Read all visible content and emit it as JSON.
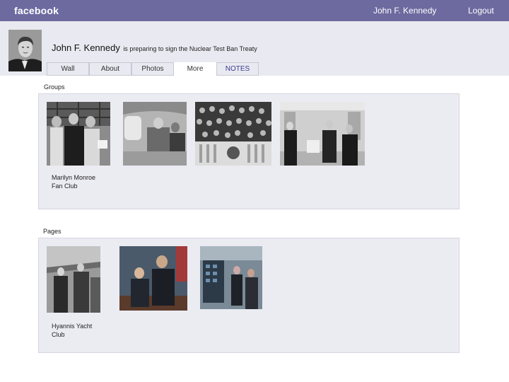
{
  "header": {
    "logo": "facebook",
    "user_name": "John F. Kennedy",
    "logout": "Logout"
  },
  "profile": {
    "name": "John F. Kennedy",
    "status": "is preparing to sign the Nuclear Test Ban Treaty"
  },
  "tabs": [
    {
      "label": "Wall"
    },
    {
      "label": "About"
    },
    {
      "label": "Photos"
    },
    {
      "label": "More",
      "active": true
    },
    {
      "label": "NOTES"
    }
  ],
  "groups": {
    "heading": "Groups",
    "items": [
      {
        "caption_line1": "Marilyn Monroe",
        "caption_line2": "Fan Club",
        "photo": "wedding-photo"
      },
      {
        "caption_line1": "",
        "caption_line2": "",
        "photo": "airplane-photo"
      },
      {
        "caption_line1": "",
        "caption_line2": "",
        "photo": "crowd-photo"
      },
      {
        "caption_line1": "",
        "caption_line2": "",
        "photo": "oval-office-photo"
      }
    ]
  },
  "pages": {
    "heading": "Pages",
    "items": [
      {
        "caption_line1": "Hyannis Yacht",
        "caption_line2": "Club",
        "photo": "dock-photo"
      },
      {
        "caption_line1": "",
        "caption_line2": "",
        "photo": "meeting-photo"
      },
      {
        "caption_line1": "",
        "caption_line2": "",
        "photo": "control-room-photo"
      }
    ]
  },
  "colors": {
    "topbar": "#6d6aa0",
    "band": "#e9e9f1",
    "panel": "#ebebf2"
  }
}
